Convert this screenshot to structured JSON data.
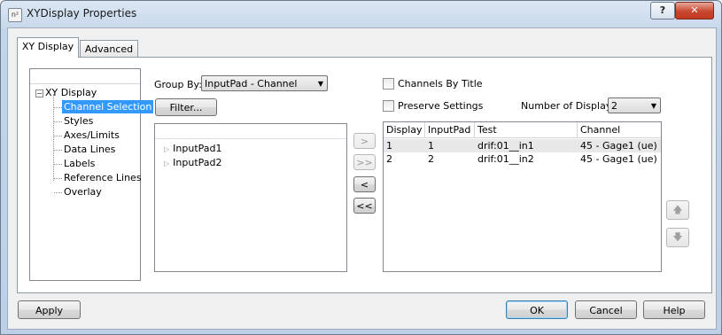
{
  "window": {
    "title": "XYDisplay Properties",
    "icon": "app-icon"
  },
  "title_buttons": {
    "help": "?",
    "close": "✕"
  },
  "tabs": [
    {
      "label": "XY Display",
      "active": true
    },
    {
      "label": "Advanced",
      "active": false
    }
  ],
  "tree": {
    "root": "XY Display",
    "expander": "−",
    "items": [
      "Channel Selection",
      "Styles",
      "Axes/Limits",
      "Data Lines",
      "Labels",
      "Reference Lines",
      "Overlay"
    ],
    "selected": "Channel Selection"
  },
  "group_by": {
    "label": "Group By:",
    "value": "InputPad - Channel"
  },
  "filter_button": "Filter...",
  "available": {
    "items": [
      "InputPad1",
      "InputPad2"
    ]
  },
  "move_buttons": {
    "add": ">",
    "add_all": ">>",
    "remove": "<",
    "remove_all": "<<"
  },
  "options": {
    "channels_by_title": {
      "label": "Channels By Title",
      "checked": false
    },
    "preserve_settings": {
      "label": "Preserve Settings",
      "checked": false
    }
  },
  "num_displays": {
    "label": "Number of Displays:",
    "value": "2"
  },
  "selected_table": {
    "columns": [
      "Display",
      "InputPad",
      "Test",
      "Channel"
    ],
    "rows": [
      {
        "display": "1",
        "inputpad": "1",
        "test": "drif:01__in1",
        "channel": "45 - Gage1 (ue)"
      },
      {
        "display": "2",
        "inputpad": "2",
        "test": "drif:01__in2",
        "channel": "45 - Gage1 (ue)"
      }
    ]
  },
  "order_buttons": {
    "up": "🡅",
    "down": "🡇"
  },
  "footer": {
    "apply": "Apply",
    "ok": "OK",
    "cancel": "Cancel",
    "help": "Help"
  },
  "colors": {
    "selection": "#3399ff",
    "title_gradient": "#c8d9ec",
    "close_button": "#c8472f"
  }
}
